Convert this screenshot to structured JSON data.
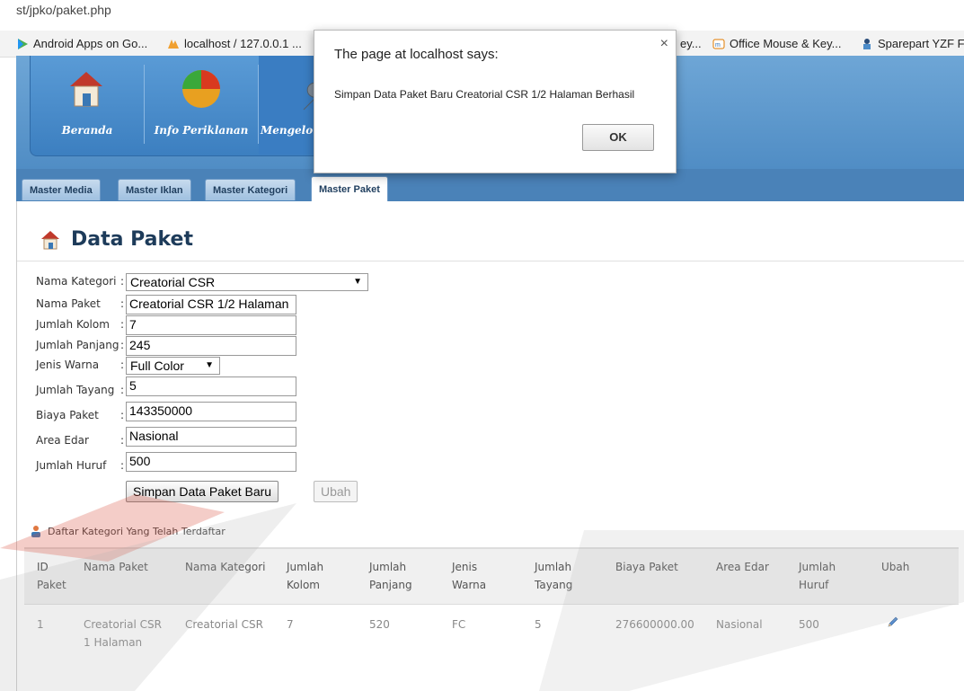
{
  "browser": {
    "url": "st/jpko/paket.php",
    "bookmarks": [
      {
        "label": "Android Apps on Go...",
        "icon": "play-store-icon"
      },
      {
        "label": "localhost / 127.0.0.1 ...",
        "icon": "phpmyadmin-icon"
      },
      {
        "label": "ey...",
        "icon": ""
      },
      {
        "label": "Office Mouse & Key...",
        "icon": "shop-icon"
      },
      {
        "label": "Sparepart YZF F",
        "icon": "spare-icon"
      }
    ]
  },
  "nav": {
    "items": [
      {
        "label": "Beranda",
        "icon": "home-icon"
      },
      {
        "label": "Info Periklanan",
        "icon": "pie-chart-icon"
      },
      {
        "label": "Mengelo",
        "icon": "wrench-icon"
      }
    ]
  },
  "tabs": [
    "Master Media",
    "Master Iklan",
    "Master Kategori",
    "Master Paket"
  ],
  "active_tab": "Master Paket",
  "page_title": "Data Paket",
  "form": {
    "fields": [
      {
        "label": "Nama Kategori",
        "value": "Creatorial CSR",
        "type": "select"
      },
      {
        "label": "Nama Paket",
        "value": "Creatorial CSR 1/2 Halaman",
        "type": "text"
      },
      {
        "label": "Jumlah Kolom",
        "value": "7",
        "type": "text"
      },
      {
        "label": "Jumlah Panjang",
        "value": "245",
        "type": "text"
      },
      {
        "label": "Jenis Warna",
        "value": "Full Color",
        "type": "select"
      },
      {
        "label": "Jumlah Tayang",
        "value": "5",
        "type": "text"
      },
      {
        "label": "Biaya Paket",
        "value": "143350000",
        "type": "text"
      },
      {
        "label": "Area Edar",
        "value": "Nasional",
        "type": "text"
      },
      {
        "label": "Jumlah Huruf",
        "value": "500",
        "type": "text"
      }
    ],
    "colon": ":",
    "save_label": "Simpan Data Paket Baru",
    "edit_label": "Ubah"
  },
  "list": {
    "title": "Daftar Kategori Yang Telah Terdaftar",
    "headers": [
      [
        "ID",
        "Paket"
      ],
      [
        "Nama Paket"
      ],
      [
        "Nama Kategori"
      ],
      [
        "Jumlah",
        "Kolom"
      ],
      [
        "Jumlah",
        "Panjang"
      ],
      [
        "Jenis",
        "Warna"
      ],
      [
        "Jumlah",
        "Tayang"
      ],
      [
        "Biaya Paket"
      ],
      [
        "Area Edar"
      ],
      [
        "Jumlah",
        "Huruf"
      ],
      [
        "Ubah"
      ]
    ],
    "rows": [
      {
        "id": "1",
        "nama_paket": [
          "Creatorial CSR",
          "1 Halaman"
        ],
        "nama_kategori": "Creatorial CSR",
        "jumlah_kolom": "7",
        "jumlah_panjang": "520",
        "jenis_warna": "FC",
        "jumlah_tayang": "5",
        "biaya_paket": "276600000.00",
        "area_edar": "Nasional",
        "jumlah_huruf": "500"
      }
    ]
  },
  "dialog": {
    "title": "The page at localhost says:",
    "message": "Simpan Data Paket Baru Creatorial CSR 1/2 Halaman Berhasil",
    "ok_label": "OK",
    "close_glyph": "×"
  },
  "colors": {
    "header_blue": "#4f8cc4",
    "tab_blue": "#4a82b8",
    "title_navy": "#1d3b5a"
  }
}
